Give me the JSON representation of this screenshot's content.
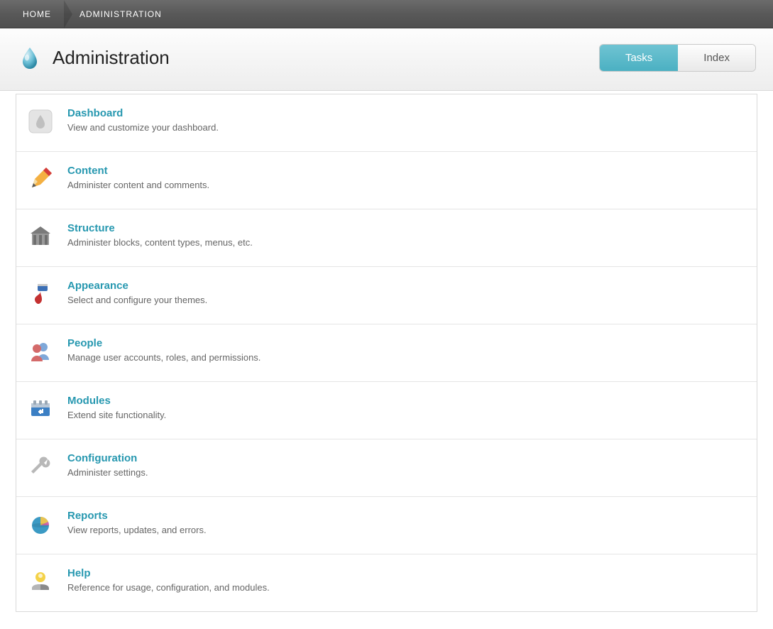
{
  "breadcrumb": {
    "home": "HOME",
    "administration": "ADMINISTRATION"
  },
  "header": {
    "title": "Administration",
    "tabs": {
      "tasks": "Tasks",
      "index": "Index"
    }
  },
  "items": [
    {
      "title": "Dashboard",
      "desc": "View and customize your dashboard."
    },
    {
      "title": "Content",
      "desc": "Administer content and comments."
    },
    {
      "title": "Structure",
      "desc": "Administer blocks, content types, menus, etc."
    },
    {
      "title": "Appearance",
      "desc": "Select and configure your themes."
    },
    {
      "title": "People",
      "desc": "Manage user accounts, roles, and permissions."
    },
    {
      "title": "Modules",
      "desc": "Extend site functionality."
    },
    {
      "title": "Configuration",
      "desc": "Administer settings."
    },
    {
      "title": "Reports",
      "desc": "View reports, updates, and errors."
    },
    {
      "title": "Help",
      "desc": "Reference for usage, configuration, and modules."
    }
  ]
}
